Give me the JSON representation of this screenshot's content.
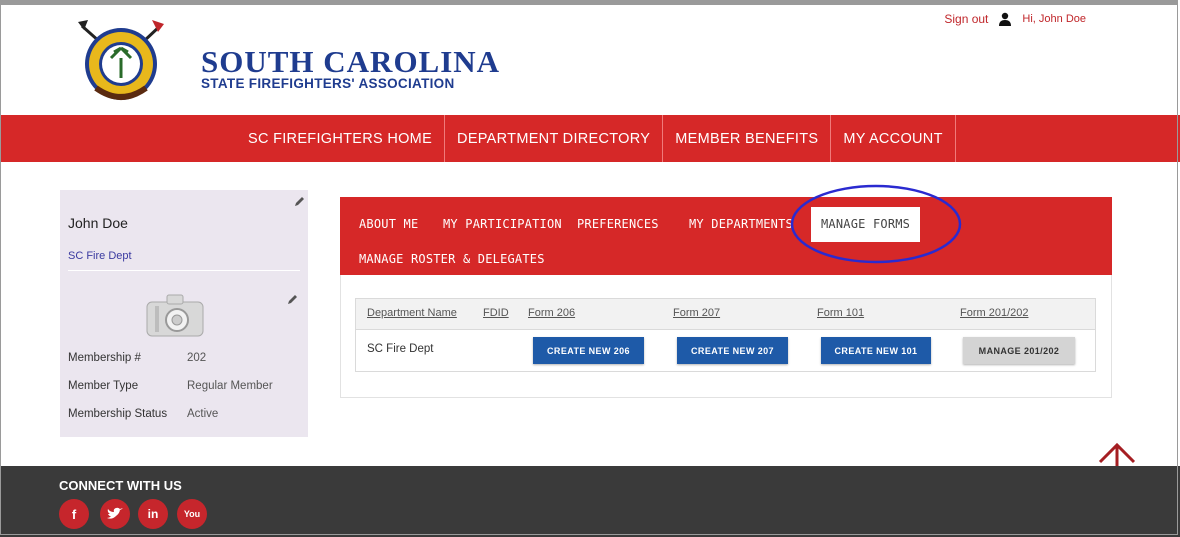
{
  "header": {
    "brand_line1": "SOUTH CAROLINA",
    "brand_line2": "STATE FIREFIGHTERS' ASSOCIATION",
    "seal_text": "SOUTH CAROLINA STATE FIREFIGHTERS' ASSOCIATION",
    "signout_label": "Sign out",
    "greeting": "Hi, John Doe"
  },
  "mainnav": {
    "items": [
      {
        "label": "SC FIREFIGHTERS HOME"
      },
      {
        "label": "DEPARTMENT DIRECTORY"
      },
      {
        "label": "MEMBER BENEFITS"
      },
      {
        "label": "MY ACCOUNT"
      }
    ]
  },
  "profile": {
    "name": "John Doe",
    "department": "SC Fire Dept",
    "fields": [
      {
        "label": "Membership #",
        "value": "202"
      },
      {
        "label": "Member Type",
        "value": "Regular Member"
      },
      {
        "label": "Membership Status",
        "value": "Active"
      }
    ]
  },
  "tabs": [
    {
      "label": "ABOUT ME"
    },
    {
      "label": "MY PARTICIPATION"
    },
    {
      "label": "PREFERENCES"
    },
    {
      "label": "MY DEPARTMENTS"
    },
    {
      "label": "MANAGE FORMS",
      "active": true
    },
    {
      "label": "MANAGE ROSTER & DELEGATES"
    }
  ],
  "forms_table": {
    "columns": [
      "Department Name",
      "FDID",
      "Form 206",
      "Form 207",
      "Form 101",
      "Form 201/202"
    ],
    "rows": [
      {
        "department": "SC Fire Dept",
        "fdid": "",
        "actions": [
          "CREATE NEW 206",
          "CREATE NEW 207",
          "CREATE NEW 101",
          "MANAGE 201/202"
        ]
      }
    ]
  },
  "footer": {
    "title": "CONNECT WITH US",
    "social": [
      {
        "icon": "facebook-icon",
        "glyph": "f"
      },
      {
        "icon": "twitter-icon",
        "glyph": "t"
      },
      {
        "icon": "linkedin-icon",
        "glyph": "in"
      },
      {
        "icon": "youtube-icon",
        "glyph": "You"
      }
    ]
  },
  "colors": {
    "brand_red": "#d62828",
    "brand_blue": "#1f3c8f",
    "button_blue": "#1e5aa8",
    "footer_dark": "#3a3a3a",
    "annotation_circle": "#2a2ad0"
  }
}
